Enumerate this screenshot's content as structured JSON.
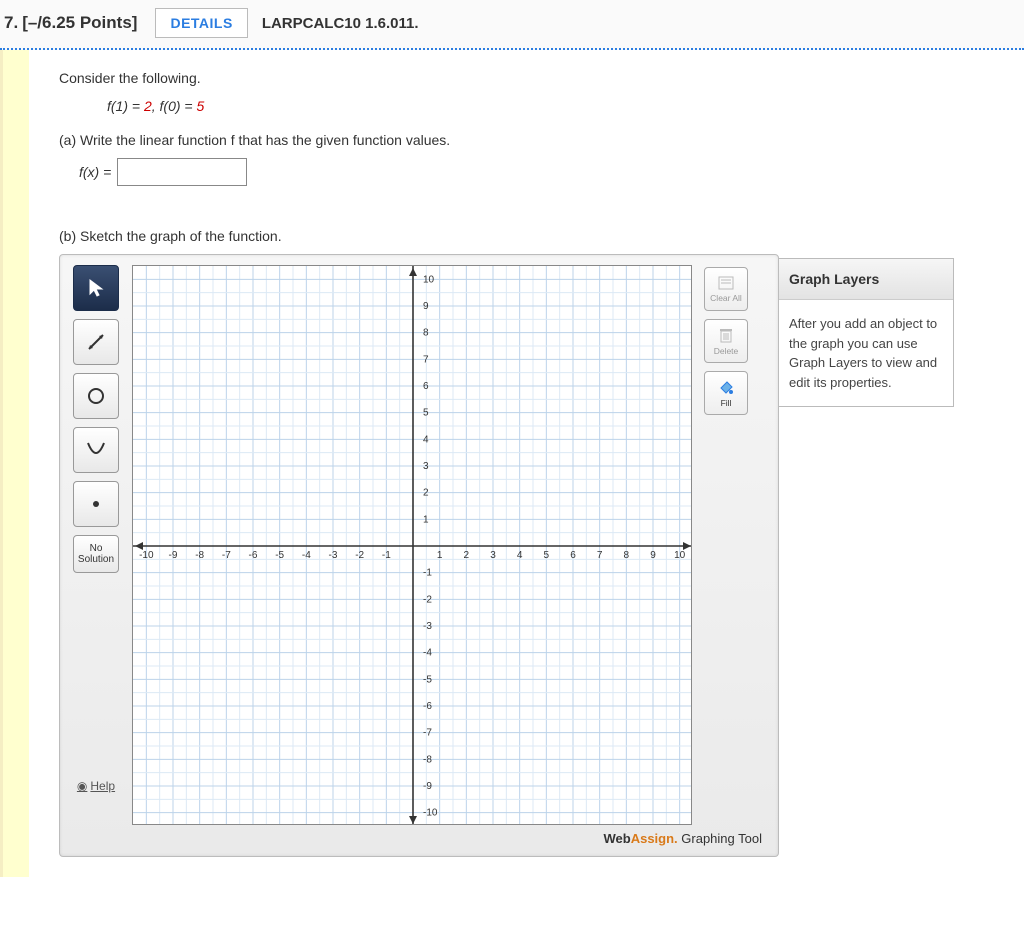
{
  "header": {
    "question_number": "7.",
    "points": "[–/6.25 Points]",
    "details_label": "DETAILS",
    "source": "LARPCALC10 1.6.011."
  },
  "problem": {
    "intro": "Consider the following.",
    "given_prefix_a": "f(1) = ",
    "given_val_a": "2",
    "given_sep": ",    ",
    "given_prefix_b": "f(0) = ",
    "given_val_b": "5",
    "part_a": "(a) Write the linear function f that has the given function values.",
    "fx_label": "f(x) =",
    "fx_value": "",
    "part_b": "(b) Sketch the graph of the function."
  },
  "tools": {
    "pointer": "Pointer",
    "line": "Line",
    "circle": "Circle",
    "parabola": "Parabola",
    "point": "Point",
    "no_solution_1": "No",
    "no_solution_2": "Solution",
    "help": "Help"
  },
  "actions": {
    "clear_all": "Clear All",
    "delete": "Delete",
    "fill": "Fill"
  },
  "brand": {
    "web": "Web",
    "assign": "Assign.",
    "tool": " Graphing Tool"
  },
  "layers": {
    "title": "Graph Layers",
    "body": "After you add an object to the graph you can use Graph Layers to view and edit its properties."
  },
  "chart_data": {
    "type": "scatter",
    "xlim": [
      -10.5,
      10.5
    ],
    "ylim": [
      -10.5,
      10.5
    ],
    "x_ticks": [
      -10,
      -9,
      -8,
      -7,
      -6,
      -5,
      -4,
      -3,
      -2,
      -1,
      1,
      2,
      3,
      4,
      5,
      6,
      7,
      8,
      9,
      10
    ],
    "y_ticks": [
      -10,
      -9,
      -8,
      -7,
      -6,
      -5,
      -4,
      -3,
      -2,
      -1,
      1,
      2,
      3,
      4,
      5,
      6,
      7,
      8,
      9,
      10
    ],
    "grid": true,
    "series": []
  }
}
